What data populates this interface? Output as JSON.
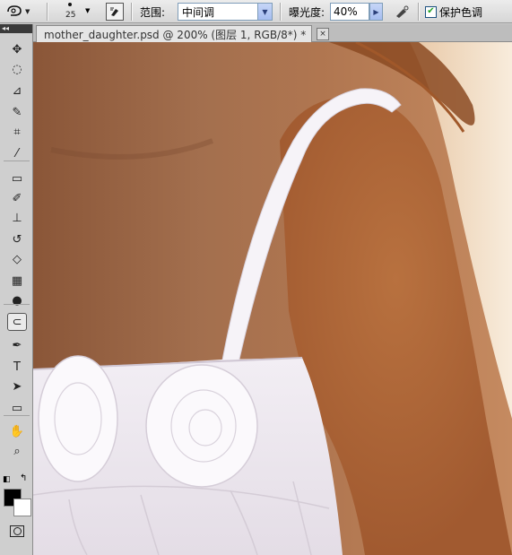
{
  "options_bar": {
    "tool_preset_icon": "sponge-tool-icon",
    "brush_size": "25",
    "brush_panel_icon": "brush-panel-icon",
    "range_label": "范围:",
    "range_value": "中间调",
    "exposure_label": "曝光度:",
    "exposure_value": "40%",
    "airbrush_icon": "airbrush-icon",
    "protect_tones_label": "保护色调",
    "protect_tones_checked": true
  },
  "document": {
    "tab_title": "mother_daughter.psd @ 200% (图层 1, RGB/8*) *",
    "close_label": "×"
  },
  "toolbox": {
    "collapse_label": "◂◂",
    "tools": [
      {
        "name": "move-tool",
        "icon": "move-icon",
        "glyph": "✥"
      },
      {
        "name": "marquee-tool",
        "icon": "ellipse-marquee-icon",
        "glyph": "◌"
      },
      {
        "name": "lasso-tool",
        "icon": "polygon-lasso-icon",
        "glyph": "⊿"
      },
      {
        "name": "quick-selection-tool",
        "icon": "quick-selection-icon",
        "glyph": "✎"
      },
      {
        "name": "crop-tool",
        "icon": "crop-icon",
        "glyph": "⌗"
      },
      {
        "name": "eyedropper-tool",
        "icon": "eyedropper-icon",
        "glyph": "⁄"
      },
      {
        "name": "healing-brush-tool",
        "icon": "bandage-icon",
        "glyph": "▭"
      },
      {
        "name": "brush-tool",
        "icon": "brush-icon",
        "glyph": "✐"
      },
      {
        "name": "clone-stamp-tool",
        "icon": "stamp-icon",
        "glyph": "⊥"
      },
      {
        "name": "history-brush-tool",
        "icon": "history-brush-icon",
        "glyph": "↺"
      },
      {
        "name": "eraser-tool",
        "icon": "eraser-icon",
        "glyph": "◇"
      },
      {
        "name": "gradient-tool",
        "icon": "gradient-icon",
        "glyph": "▦"
      },
      {
        "name": "blur-tool",
        "icon": "drop-icon",
        "glyph": "●"
      },
      {
        "name": "sponge-tool",
        "icon": "sponge-icon",
        "glyph": "⊂"
      },
      {
        "name": "pen-tool",
        "icon": "pen-icon",
        "glyph": "✒"
      },
      {
        "name": "type-tool",
        "icon": "type-icon",
        "glyph": "T"
      },
      {
        "name": "path-selection-tool",
        "icon": "arrow-icon",
        "glyph": "➤"
      },
      {
        "name": "shape-tool",
        "icon": "rectangle-icon",
        "glyph": "▭"
      },
      {
        "name": "hand-tool",
        "icon": "hand-icon",
        "glyph": "✋"
      },
      {
        "name": "zoom-tool",
        "icon": "zoom-icon",
        "glyph": "⌕"
      }
    ],
    "active_tool": "sponge-tool",
    "foreground_color": "#000000",
    "background_color": "#ffffff",
    "quick_mask_icon": "quick-mask-icon"
  }
}
